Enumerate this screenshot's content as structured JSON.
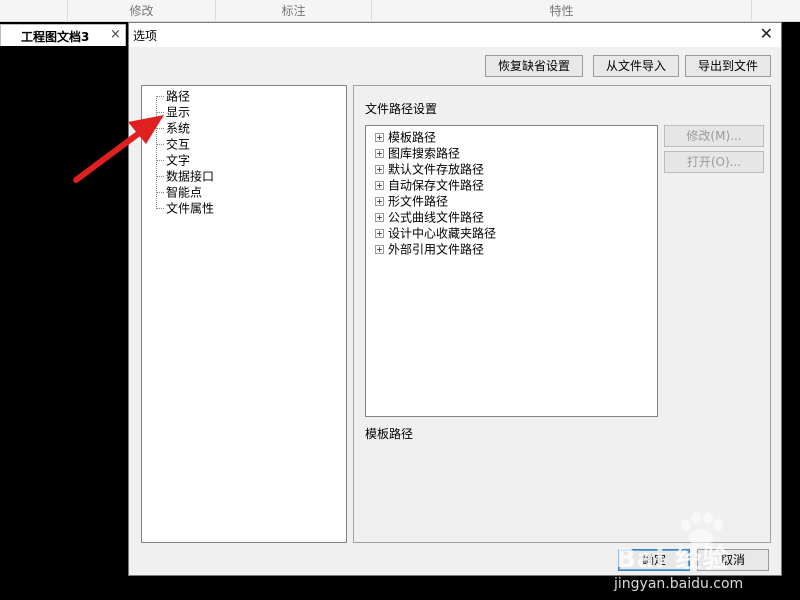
{
  "ribbon": {
    "cells": [
      "",
      "修改",
      "标注",
      "特性",
      ""
    ]
  },
  "doc_tab": {
    "title": "工程图文档3",
    "close": "×"
  },
  "dialog": {
    "title": "选项",
    "close": "✕",
    "buttons": {
      "restore_defaults": "恢复缺省设置",
      "import_from_file": "从文件导入",
      "export_to_file": "导出到文件",
      "modify": "修改(M)...",
      "open": "打开(O)...",
      "ok": "确定",
      "cancel": "取消"
    },
    "tree": [
      "路径",
      "显示",
      "系统",
      "交互",
      "文字",
      "数据接口",
      "智能点",
      "文件属性"
    ],
    "group_title": "文件路径设置",
    "paths": [
      "模板路径",
      "图库搜索路径",
      "默认文件存放路径",
      "自动保存文件路径",
      "形文件路径",
      "公式曲线文件路径",
      "设计中心收藏夹路径",
      "外部引用文件路径"
    ],
    "description": "模板路径"
  },
  "colors": {
    "arrow": "#e02020",
    "background": "#000000",
    "dialog_bg": "#f0f0f0"
  },
  "watermark": {
    "text": "Bai 经验",
    "url": "jingyan.baidu.com"
  }
}
